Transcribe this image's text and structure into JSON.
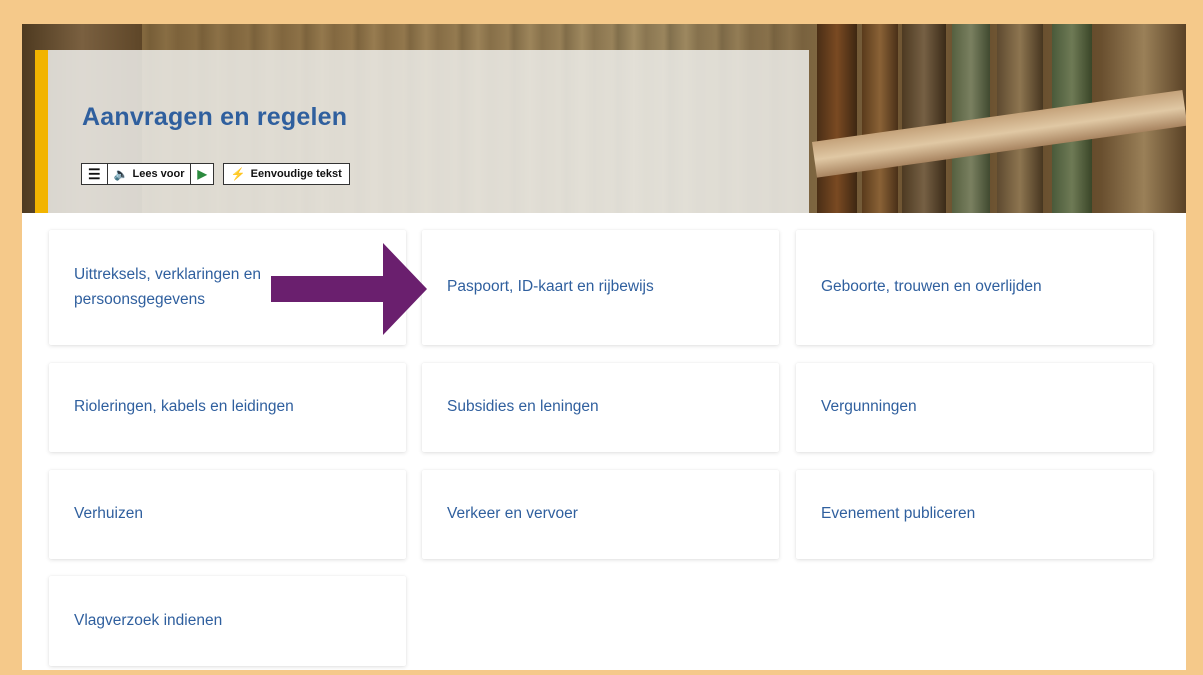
{
  "hero": {
    "title": "Aanvragen en regelen",
    "accent_color": "#f2b400",
    "title_color": "#2f5f9e"
  },
  "readspeaker": {
    "menu_icon": "hamburger-icon",
    "speaker_icon": "speaker-icon",
    "read_label": "Lees voor",
    "play_icon": "play-icon",
    "easy_icon": "lightning-icon",
    "easy_label": "Eenvoudige tekst"
  },
  "cards": [
    {
      "label": "Uittreksels, verklaringen en persoonsgegevens"
    },
    {
      "label": "Paspoort, ID-kaart en rijbewijs"
    },
    {
      "label": "Geboorte, trouwen en overlijden"
    },
    {
      "label": "Rioleringen, kabels en leidingen"
    },
    {
      "label": "Subsidies en leningen"
    },
    {
      "label": "Vergunningen"
    },
    {
      "label": "Verhuizen"
    },
    {
      "label": "Verkeer en vervoer"
    },
    {
      "label": "Evenement publiceren"
    },
    {
      "label": "Vlagverzoek indienen"
    }
  ],
  "annotation": {
    "arrow_color": "#6a1f6e",
    "arrow_icon": "right-arrow-icon"
  },
  "frame_color": "#f5c98a"
}
